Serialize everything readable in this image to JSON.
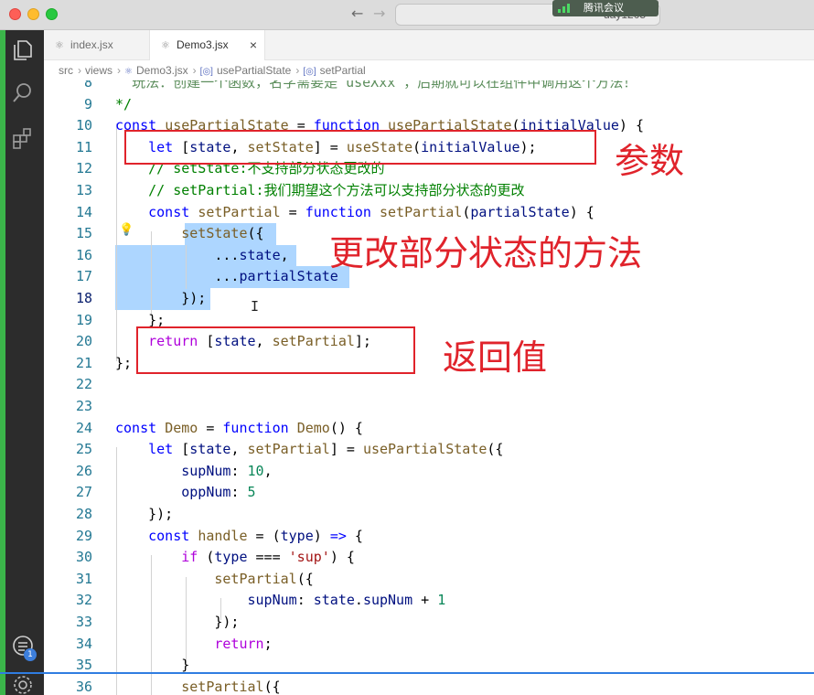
{
  "window": {
    "meeting_label": "腾讯会议",
    "search_text": "day1205"
  },
  "tabs": [
    {
      "label": "index.jsx"
    },
    {
      "label": "Demo3.jsx",
      "close": "×"
    }
  ],
  "breadcrumb": [
    "src",
    "views",
    "Demo3.jsx",
    "usePartialState",
    "setPartial"
  ],
  "badge_count": "1",
  "line_numbers": [
    "8",
    "9",
    "10",
    "11",
    "12",
    "13",
    "14",
    "15",
    "16",
    "17",
    "18",
    "19",
    "20",
    "21",
    "22",
    "23",
    "24",
    "25",
    "26",
    "27",
    "28",
    "29",
    "30",
    "31",
    "32",
    "33",
    "34",
    "35",
    "36"
  ],
  "code": {
    "l8": "玩法：创建一个函数，名字需要是 useXxx ，后期就可以在组件中调用这个方法！",
    "l9": "*/",
    "l12": "// setState:不支持部分状态更改的",
    "l13": "// setPartial:我们期望这个方法可以支持部分状态的更改"
  },
  "annotations": {
    "params": "参数",
    "method": "更改部分状态的方法",
    "return_value": "返回值"
  },
  "colors": {
    "annotation_red": "#e0232b",
    "selection": "#add6ff",
    "keyword": "#0000ff",
    "variable": "#001080",
    "function": "#795e26",
    "number": "#098658",
    "string": "#a31515",
    "activity_accent": "#3bb54a"
  },
  "icons": [
    "explorer-icon",
    "search-icon",
    "extensions-icon",
    "remote-icon",
    "settings-gear-icon",
    "react-file-icon",
    "lightbulb-icon",
    "close-icon"
  ]
}
